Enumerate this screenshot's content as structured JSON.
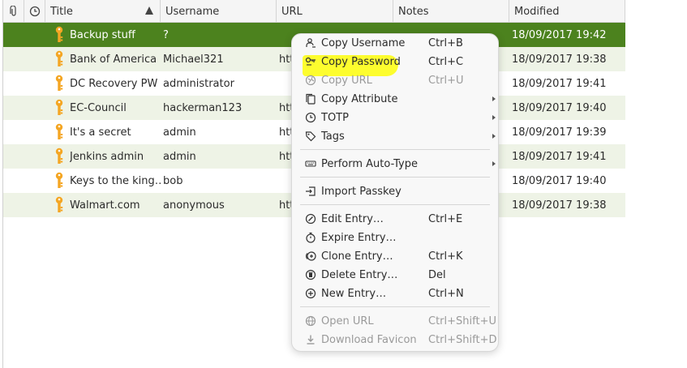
{
  "header": {
    "attach_icon": "paperclip-icon",
    "time_icon": "clock-icon",
    "title": "Title",
    "username": "Username",
    "url": "URL",
    "notes": "Notes",
    "modified": "Modified"
  },
  "rows": [
    {
      "title": "Backup stuff",
      "username": "?",
      "url": "",
      "notes": "",
      "modified": "18/09/2017 19:42"
    },
    {
      "title": "Bank of America",
      "username": "Michael321",
      "url": "htt",
      "notes": "",
      "modified": "18/09/2017 19:38"
    },
    {
      "title": "DC Recovery PW",
      "username": "administrator",
      "url": "",
      "notes": "",
      "modified": "18/09/2017 19:41"
    },
    {
      "title": "EC-Council",
      "username": "hackerman123",
      "url": "htt",
      "notes": "",
      "modified": "18/09/2017 19:40"
    },
    {
      "title": "It's a secret",
      "username": "admin",
      "url": "htt",
      "notes": "",
      "modified": "18/09/2017 19:39"
    },
    {
      "title": "Jenkins admin",
      "username": "admin",
      "url": "htt",
      "notes": "..",
      "modified": "18/09/2017 19:41"
    },
    {
      "title": "Keys to the king…",
      "username": "bob",
      "url": "",
      "notes": "",
      "modified": "18/09/2017 19:40"
    },
    {
      "title": "Walmart.com",
      "username": "anonymous",
      "url": "htt",
      "notes": "",
      "modified": "18/09/2017 19:38"
    }
  ],
  "menu": {
    "copy_username": {
      "label": "Copy Username",
      "shortcut": "Ctrl+B"
    },
    "copy_password": {
      "label": "Copy Password",
      "shortcut": "Ctrl+C"
    },
    "copy_url": {
      "label": "Copy URL",
      "shortcut": "Ctrl+U"
    },
    "copy_attribute": {
      "label": "Copy Attribute"
    },
    "totp": {
      "label": "TOTP"
    },
    "tags": {
      "label": "Tags"
    },
    "auto_type": {
      "label": "Perform Auto-Type"
    },
    "import_passkey": {
      "label": "Import Passkey"
    },
    "edit_entry": {
      "label": "Edit Entry…",
      "shortcut": "Ctrl+E"
    },
    "expire_entry": {
      "label": "Expire Entry…"
    },
    "clone_entry": {
      "label": "Clone Entry…",
      "shortcut": "Ctrl+K"
    },
    "delete_entry": {
      "label": "Delete Entry…",
      "shortcut": "Del"
    },
    "new_entry": {
      "label": "New Entry…",
      "shortcut": "Ctrl+N"
    },
    "open_url": {
      "label": "Open URL",
      "shortcut": "Ctrl+Shift+U"
    },
    "download_favicon": {
      "label": "Download Favicon",
      "shortcut": "Ctrl+Shift+D"
    }
  },
  "colors": {
    "selected_row": "#4c821e",
    "alt_row": "#eef3e6",
    "key_icon": "#f4a623",
    "highlight": "#fdfd2e"
  }
}
